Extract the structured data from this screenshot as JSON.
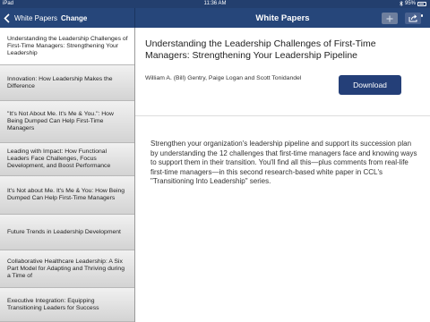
{
  "status_bar": {
    "device": "iPad",
    "time": "11:36 AM",
    "battery": "95%"
  },
  "nav": {
    "back_label": "White Papers",
    "change_label": "Change",
    "title": "White Papers"
  },
  "icons": {
    "back": "chevron-left-icon",
    "more": "more-dots-icon",
    "add": "plus-icon",
    "share": "share-icon",
    "wifi": "wifi-icon",
    "bluetooth": "bluetooth-icon",
    "battery": "battery-icon"
  },
  "colors": {
    "nav_bar": "#26467a",
    "status_bar": "#233f6e",
    "download_button": "#243f78"
  },
  "sidebar": {
    "items": [
      {
        "label": "Understanding the Leadership Challenges of First-Time Managers: Strengthening Your Leadership",
        "selected": true
      },
      {
        "label": "Innovation: How Leadership Makes the Difference",
        "selected": false
      },
      {
        "label": "\"It's Not About Me. It's Me & You.\": How Being Dumped Can Help First-Time Managers",
        "selected": false
      },
      {
        "label": "Leading with Impact: How Functional Leaders Face Challenges, Focus Development, and Boost Performance",
        "selected": false
      },
      {
        "label": "It's Not about Me. It's Me & You: How Being Dumped Can Help First-Time Managers",
        "selected": false
      },
      {
        "label": "Future Trends in Leadership Development",
        "selected": false
      },
      {
        "label": "Collaborative Healthcare Leadership: A Six Part Model for Adapting and Thriving during a Time of",
        "selected": false
      },
      {
        "label": "Executive Integration: Equipping Transitioning Leaders for Success",
        "selected": false
      }
    ]
  },
  "detail": {
    "title": "Understanding the Leadership Challenges of First-Time Managers: Strengthening Your Leadership Pipeline",
    "authors": "William A. (Bill) Gentry, Paige Logan and Scott Tonidandel",
    "download_label": "Download",
    "description": "Strengthen your organization's leadership pipeline and support its succession plan by understanding the 12 challenges that first-time managers face and knowing ways to support them in their transition. You'll find all this—plus comments from real-life first-time managers—in this second research-based white paper in CCL's \"Transitioning Into Leadership\" series."
  }
}
